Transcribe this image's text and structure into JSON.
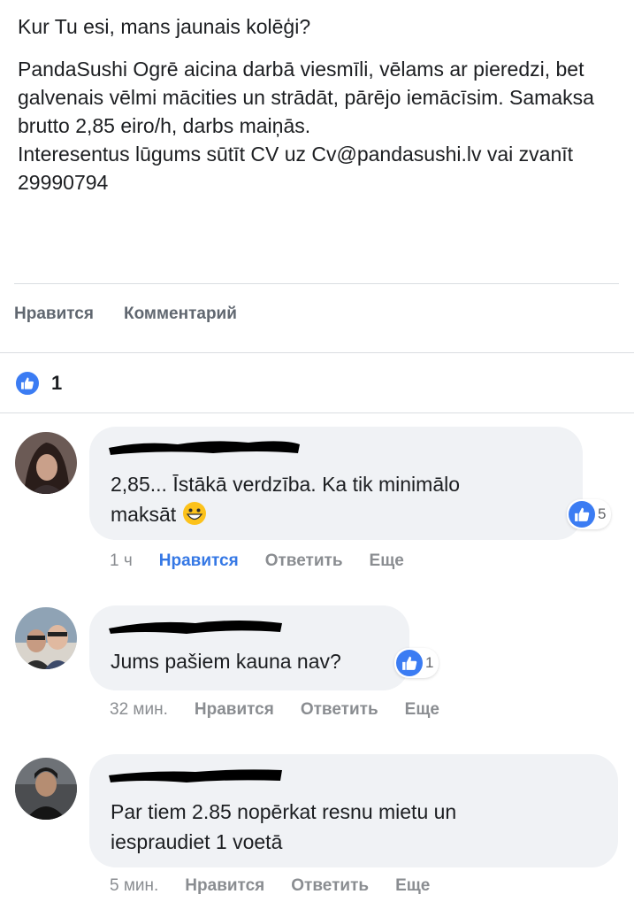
{
  "post": {
    "line1": "Kur Tu esi, mans jaunais kolēģi?",
    "line2": "PandaSushi Ogrē aicina darbā viesmīli, vēlams ar pieredzi, bet galvenais vēlmi mācities un strādāt, pārējo iemācīsim. Samaksa brutto 2,85 eiro/h, darbs maiņās.",
    "line3": "Interesentus lūgums sūtīt CV uz Cv@pandasushi.lv vai zvanīt 29990794"
  },
  "actions": {
    "like": "Нравится",
    "comment": "Комментарий"
  },
  "reactions": {
    "count": "1"
  },
  "comments": [
    {
      "text_line1": "2,85... Īstākā verdzība. Ka tik minimālo",
      "text_line2": "maksāt",
      "emoji": "grinning-face",
      "likes": "5",
      "time": "1 ч",
      "like_label": "Нравится",
      "reply_label": "Ответить",
      "more_label": "Еще"
    },
    {
      "text_line1": "Jums pašiem kauna nav?",
      "likes": "1",
      "time": "32 мин.",
      "like_label": "Нравится",
      "reply_label": "Ответить",
      "more_label": "Еще"
    },
    {
      "text_line1": "Par tiem 2.85 nopērkat resnu mietu un",
      "text_line2": "iespraudiet 1 voetā",
      "time": "5 мин.",
      "like_label": "Нравится",
      "reply_label": "Ответить",
      "more_label": "Еще"
    }
  ],
  "colors": {
    "accent": "#3578e5",
    "like_badge": "#3b7cf3",
    "bubble": "#f0f2f5",
    "muted": "#8a8d91"
  }
}
